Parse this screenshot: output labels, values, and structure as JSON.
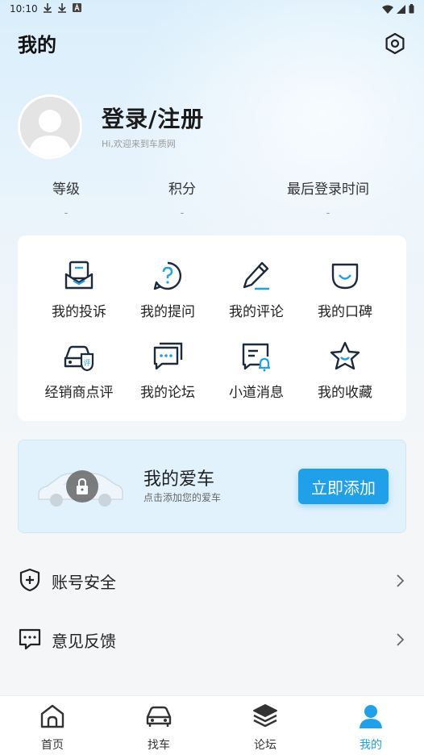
{
  "status_bar": {
    "time": "10:10"
  },
  "header": {
    "title": "我的"
  },
  "profile": {
    "login_label": "登录/注册",
    "welcome": "Hi,欢迎来到车质网"
  },
  "stats": [
    {
      "label": "等级",
      "value": "-"
    },
    {
      "label": "积分",
      "value": "-"
    },
    {
      "label": "最后登录时间",
      "value": "-"
    }
  ],
  "grid": [
    {
      "label": "我的投诉",
      "icon": "complaint-icon"
    },
    {
      "label": "我的提问",
      "icon": "question-icon"
    },
    {
      "label": "我的评论",
      "icon": "comment-pen-icon"
    },
    {
      "label": "我的口碑",
      "icon": "reputation-icon"
    },
    {
      "label": "经销商点评",
      "icon": "dealer-review-icon"
    },
    {
      "label": "我的论坛",
      "icon": "forum-icon"
    },
    {
      "label": "小道消息",
      "icon": "news-bell-icon"
    },
    {
      "label": "我的收藏",
      "icon": "star-icon"
    }
  ],
  "my_car": {
    "title": "我的爱车",
    "subtitle": "点击添加您的爱车",
    "button": "立即添加"
  },
  "list": [
    {
      "label": "账号安全",
      "icon": "shield-icon"
    },
    {
      "label": "意见反馈",
      "icon": "feedback-icon"
    }
  ],
  "tabs": [
    {
      "label": "首页",
      "icon": "home-icon"
    },
    {
      "label": "找车",
      "icon": "car-icon"
    },
    {
      "label": "论坛",
      "icon": "layers-icon"
    },
    {
      "label": "我的",
      "icon": "user-icon",
      "active": true
    }
  ],
  "colors": {
    "accent": "#1fa0e8",
    "icon_dark": "#1c2a3a"
  }
}
